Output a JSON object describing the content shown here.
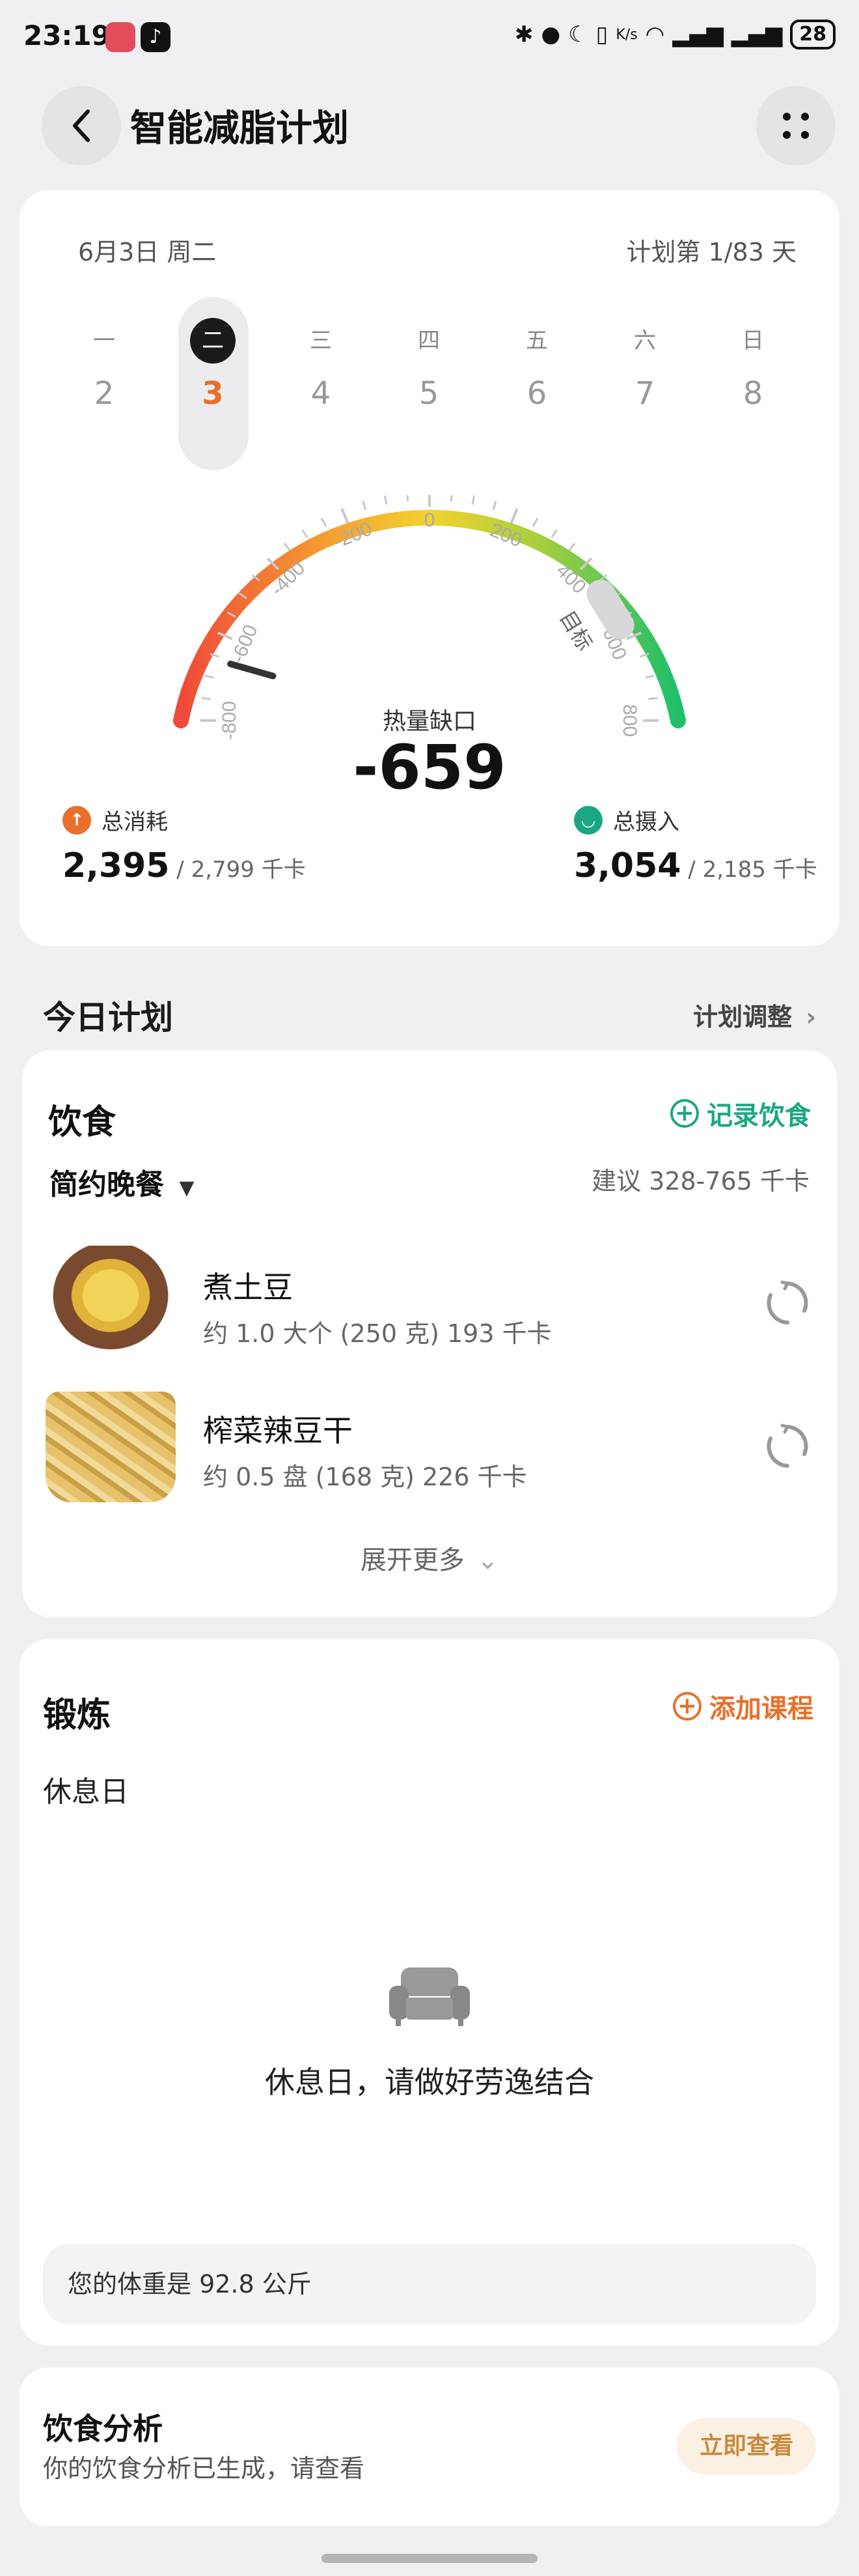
{
  "status_bar": {
    "time": "23:19",
    "network_speed": "K/s",
    "battery": "28"
  },
  "header": {
    "title": "智能减脂计划"
  },
  "calendar": {
    "date": "6月3日 周二",
    "plan_progress": "计划第 1/83 天",
    "weekdays": [
      "一",
      "二",
      "三",
      "四",
      "五",
      "六",
      "日"
    ],
    "days": [
      "2",
      "3",
      "4",
      "5",
      "6",
      "7",
      "8"
    ],
    "selected_index": 1
  },
  "gauge": {
    "ticks": [
      "-800",
      "-600",
      "-400",
      "-200",
      "0",
      "200",
      "400",
      "600",
      "800"
    ],
    "target_label": "目标",
    "deficit_label": "热量缺口",
    "deficit_value": "-659",
    "needle_value": -659,
    "min": -800,
    "max": 800
  },
  "stats": {
    "burn": {
      "label": "总消耗",
      "value": "2,395",
      "target": "2,799 千卡",
      "color": "#e8702a"
    },
    "intake": {
      "label": "总摄入",
      "value": "3,054",
      "target": "2,185 千卡",
      "color": "#1ba784"
    }
  },
  "today_plan": {
    "title": "今日计划",
    "adjust": "计划调整"
  },
  "diet": {
    "title": "饮食",
    "record": "记录饮食",
    "meal": "简约晚餐",
    "suggest": "建议 328-765 千卡",
    "foods": [
      {
        "name": "煮土豆",
        "desc": "约 1.0 大个 (250 克) 193 千卡"
      },
      {
        "name": "榨菜辣豆干",
        "desc": "约 0.5 盘 (168 克) 226 千卡"
      }
    ],
    "expand": "展开更多"
  },
  "exercise": {
    "title": "锻炼",
    "add": "添加课程",
    "rest_label": "休息日",
    "rest_msg": "休息日，请做好劳逸结合",
    "weight": "您的体重是 92.8 公斤"
  },
  "analysis": {
    "title": "饮食分析",
    "subtitle": "你的饮食分析已生成，请查看",
    "button": "立即查看"
  },
  "colors": {
    "orange": "#e8702a",
    "green": "#1ba784",
    "bg": "#f0f0f2"
  }
}
